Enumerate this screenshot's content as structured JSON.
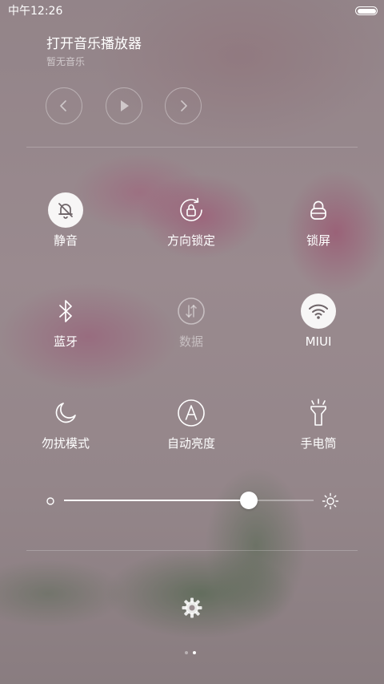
{
  "status_bar": {
    "time": "中午12:26",
    "battery_level": 1.0
  },
  "music": {
    "title": "打开音乐播放器",
    "subtitle": "暂无音乐",
    "controls": [
      "previous-icon",
      "play-icon",
      "next-icon"
    ]
  },
  "toggles": [
    {
      "label": "静音",
      "icon": "mute-bell-icon",
      "active": true,
      "disabled": false
    },
    {
      "label": "方向锁定",
      "icon": "rotation-lock-icon",
      "active": false,
      "disabled": false
    },
    {
      "label": "锁屏",
      "icon": "lock-icon",
      "active": false,
      "disabled": false
    },
    {
      "label": "蓝牙",
      "icon": "bluetooth-icon",
      "active": false,
      "disabled": false
    },
    {
      "label": "数据",
      "icon": "mobile-data-icon",
      "active": false,
      "disabled": true
    },
    {
      "label": "MIUI",
      "icon": "wifi-icon",
      "active": true,
      "disabled": false
    },
    {
      "label": "勿扰模式",
      "icon": "moon-icon",
      "active": false,
      "disabled": false
    },
    {
      "label": "自动亮度",
      "icon": "auto-brightness-icon",
      "active": false,
      "disabled": false
    },
    {
      "label": "手电筒",
      "icon": "flashlight-icon",
      "active": false,
      "disabled": false
    }
  ],
  "brightness": {
    "level": 0.74,
    "min_icon": "brightness-low-icon",
    "max_icon": "brightness-high-icon"
  },
  "settings_icon": "gear-icon",
  "pager": {
    "pages": 2,
    "current": 2
  },
  "colors": {
    "text": "#ffffff",
    "active_circle": "#ffffff",
    "active_icon": "#6e6468"
  }
}
